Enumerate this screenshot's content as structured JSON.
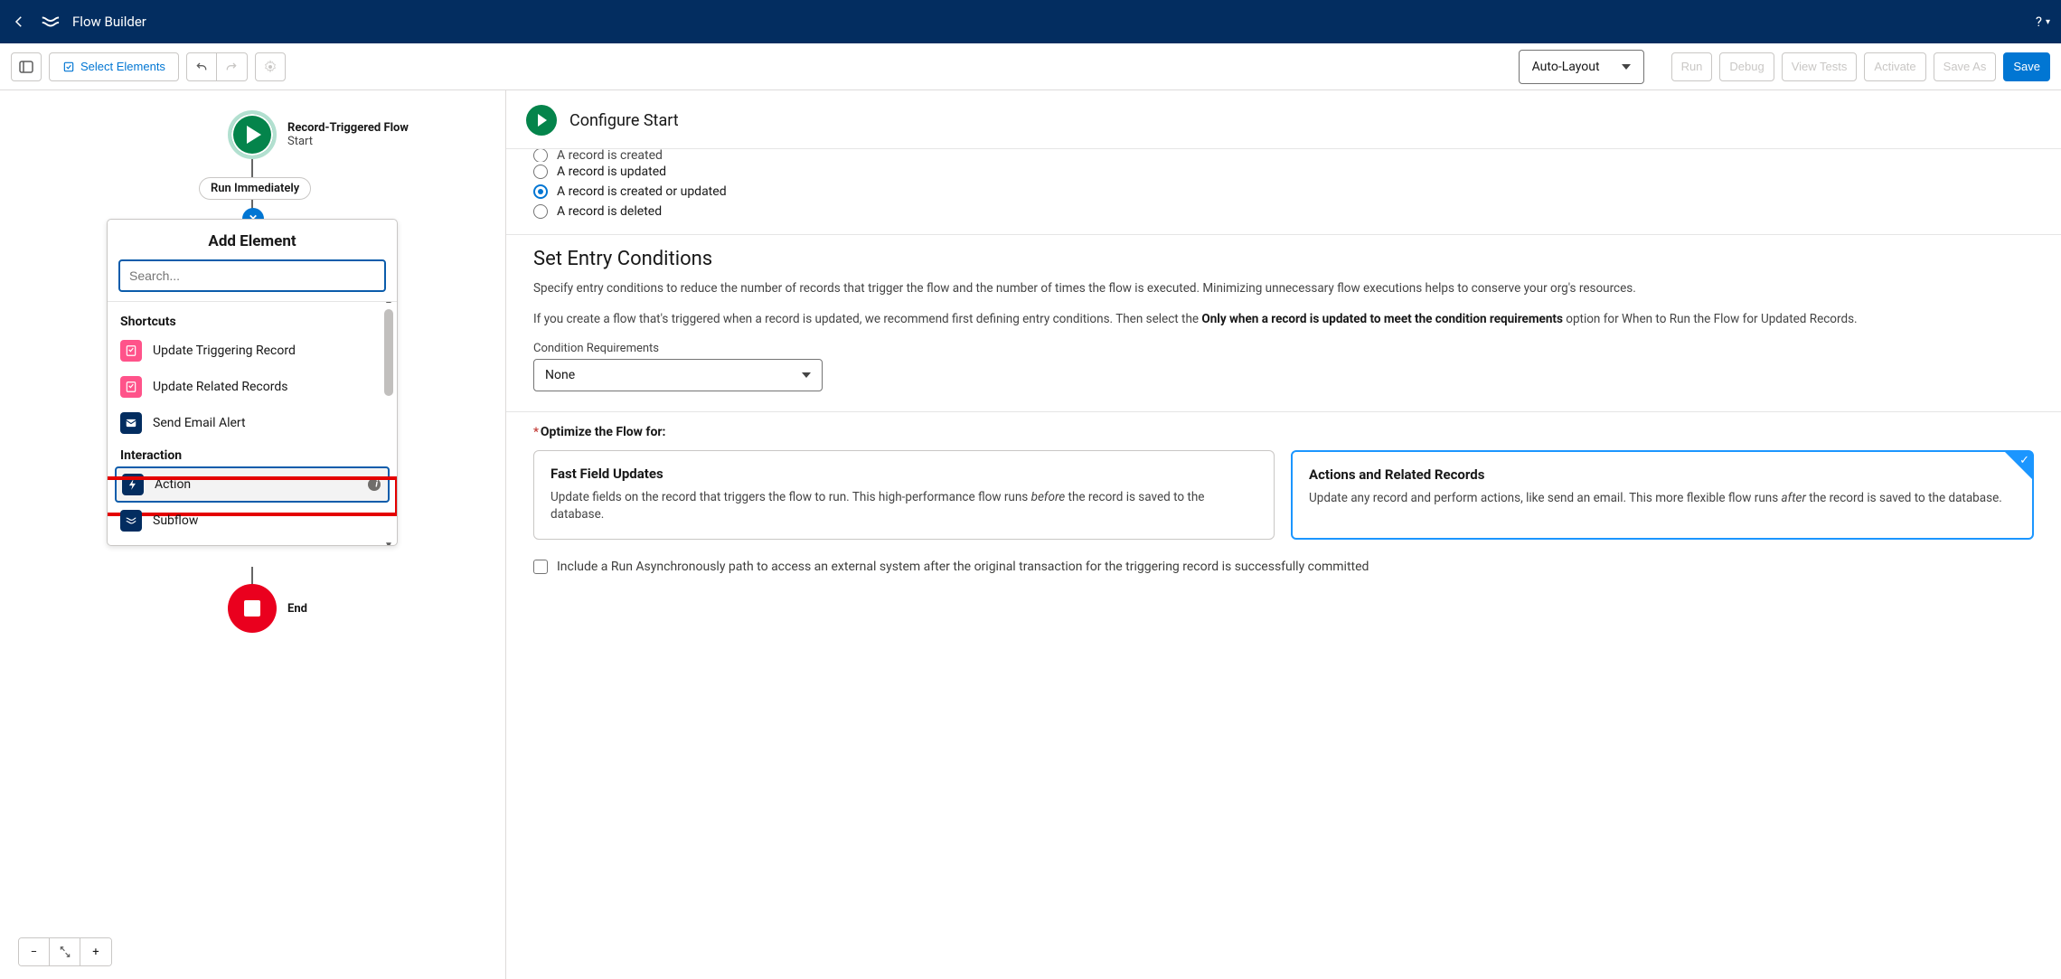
{
  "header": {
    "title": "Flow Builder"
  },
  "toolbar": {
    "select_elements": "Select Elements",
    "auto_layout": "Auto-Layout",
    "run": "Run",
    "debug": "Debug",
    "view_tests": "View Tests",
    "activate": "Activate",
    "save_as": "Save As",
    "save": "Save"
  },
  "canvas": {
    "start_title": "Record-Triggered Flow",
    "start_sub": "Start",
    "run_pill": "Run Immediately",
    "end_label": "End",
    "add_element_title": "Add Element",
    "search_placeholder": "Search...",
    "group_shortcuts": "Shortcuts",
    "group_interaction": "Interaction",
    "item_update_trigger": "Update Triggering Record",
    "item_update_related": "Update Related Records",
    "item_send_email": "Send Email Alert",
    "item_action": "Action",
    "item_subflow": "Subflow"
  },
  "config": {
    "title": "Configure Start",
    "radios": {
      "r1": "A record is created",
      "r2": "A record is updated",
      "r3": "A record is created or updated",
      "r4": "A record is deleted"
    },
    "entry_title": "Set Entry Conditions",
    "entry_desc1": "Specify entry conditions to reduce the number of records that trigger the flow and the number of times the flow is executed. Minimizing unnecessary flow executions helps to conserve your org's resources.",
    "entry_desc2_pre": "If you create a flow that's triggered when a record is updated, we recommend first defining entry conditions. Then select the ",
    "entry_desc2_bold": "Only when a record is updated to meet the condition requirements",
    "entry_desc2_post": " option for When to Run the Flow for Updated Records.",
    "cond_label": "Condition Requirements",
    "cond_value": "None",
    "optimize_label": "Optimize the Flow for:",
    "card1_title": "Fast Field Updates",
    "card1_text_a": "Update fields on the record that triggers the flow to run. This high-performance flow runs ",
    "card1_em": "before",
    "card1_text_b": " the record is saved to the database.",
    "card2_title": "Actions and Related Records",
    "card2_text_a": "Update any record and perform actions, like send an email. This more flexible flow runs ",
    "card2_em": "after",
    "card2_text_b": " the record is saved to the database.",
    "async_checkbox": "Include a Run Asynchronously path to access an external system after the original transaction for the triggering record is successfully committed"
  }
}
